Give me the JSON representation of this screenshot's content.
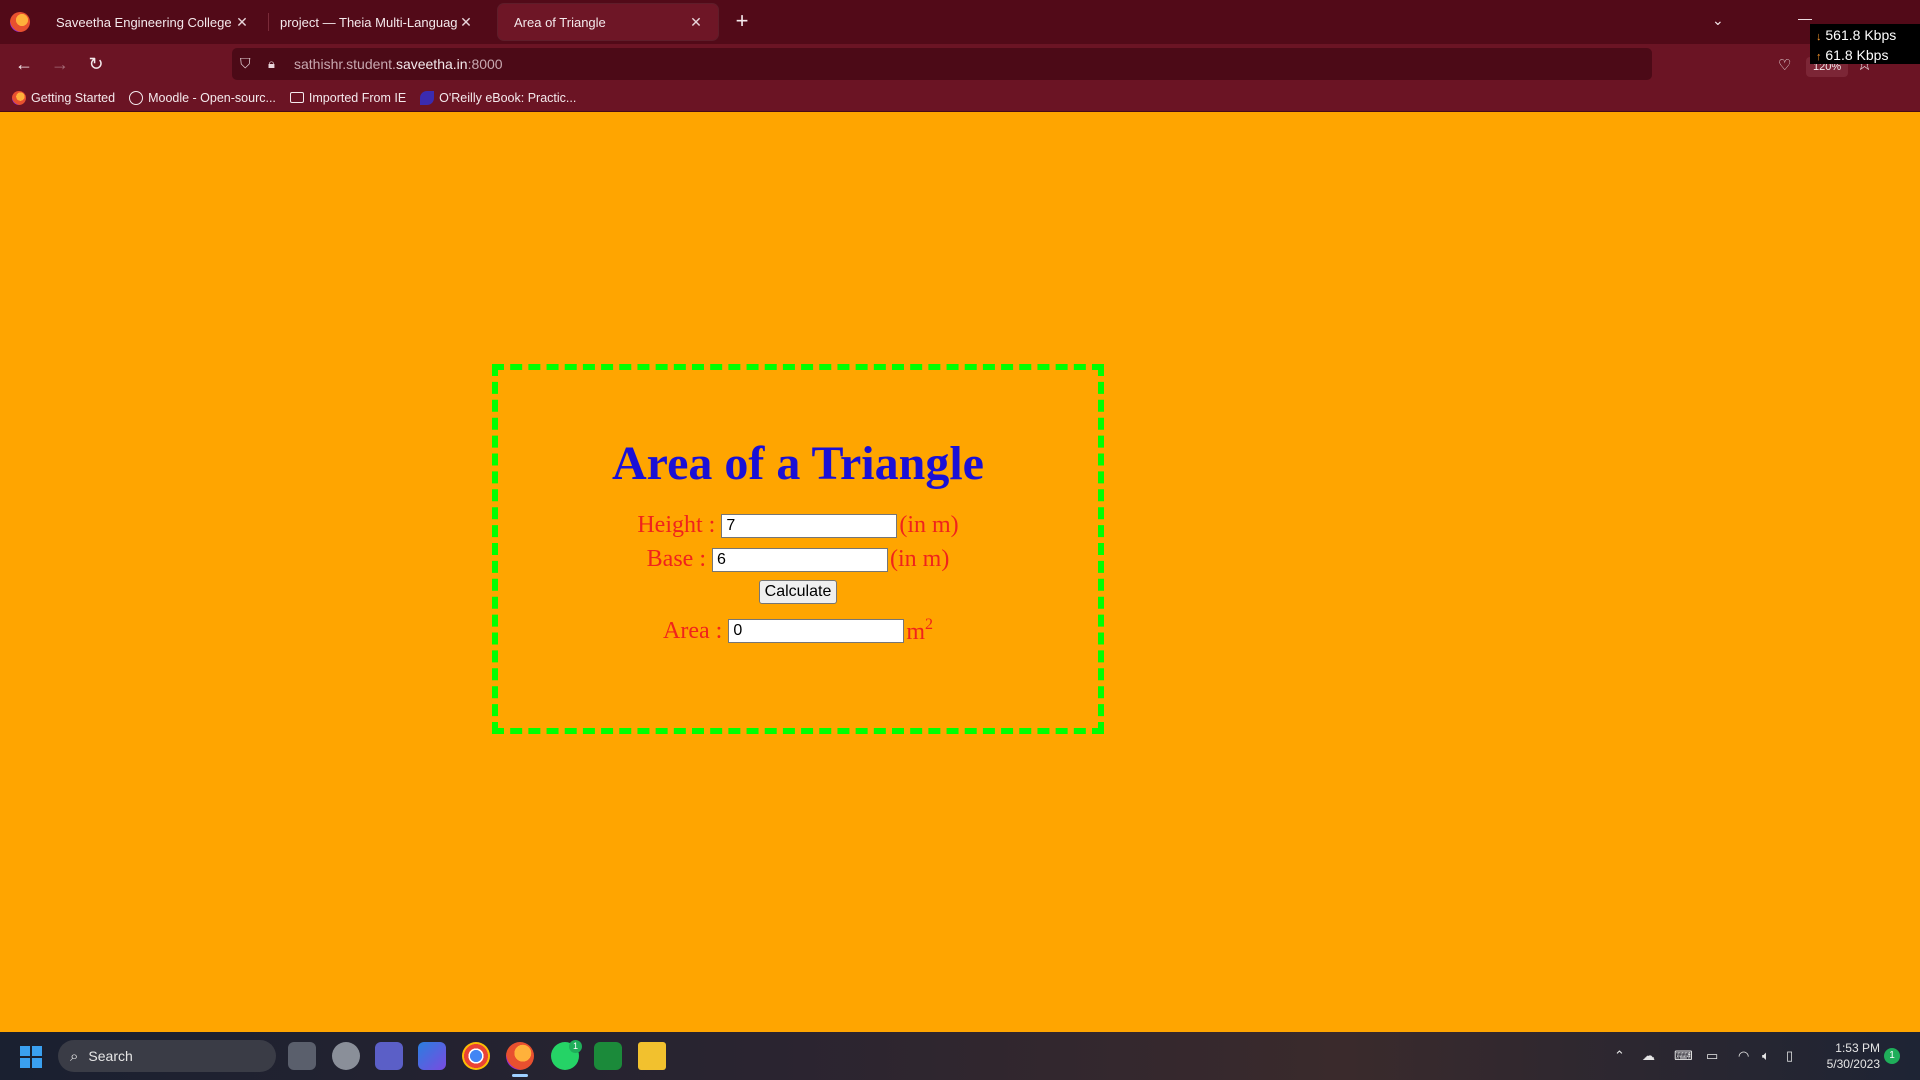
{
  "browser": {
    "tabs": [
      {
        "label": "Saveetha Engineering College",
        "active": false
      },
      {
        "label": "project — Theia Multi-Language Ex",
        "active": false
      },
      {
        "label": "Area of Triangle",
        "active": true
      }
    ],
    "address": {
      "prefix": "sathishr.student.",
      "domain": "saveetha.in",
      "suffix": ":8000"
    },
    "zoom": "120%",
    "bookmarks": [
      {
        "label": "Getting Started",
        "icon": "firefox-icon"
      },
      {
        "label": "Moodle - Open-sourc...",
        "icon": "globe-icon"
      },
      {
        "label": "Imported From IE",
        "icon": "folder-icon"
      },
      {
        "label": "O'Reilly eBook: Practic...",
        "icon": "oreilly-icon"
      }
    ]
  },
  "netmeter": {
    "down": "561.8 Kbps",
    "up": "61.8 Kbps"
  },
  "page": {
    "title": "Area of a Triangle",
    "height": {
      "label": "Height :",
      "value": "7",
      "unit": "(in m)"
    },
    "base": {
      "label": "Base :",
      "value": "6",
      "unit": "(in m)"
    },
    "calculate_label": "Calculate",
    "area": {
      "label": "Area :",
      "value": "0",
      "unit": "m",
      "unit_exp": "2"
    }
  },
  "taskbar": {
    "search_label": "Search",
    "time": "1:53 PM",
    "date": "5/30/2023",
    "whatsapp_badge": "1",
    "notification_count": "1"
  },
  "colors": {
    "page_bg": "#ffa500",
    "title": "#1a10d6",
    "labels": "#f0231c",
    "border": "#00ff00",
    "chrome": "#520a18"
  }
}
